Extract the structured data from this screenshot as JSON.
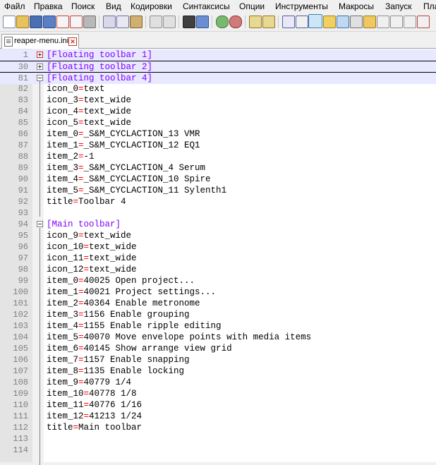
{
  "menu": [
    "Файл",
    "Правка",
    "Поиск",
    "Вид",
    "Кодировки",
    "Синтаксисы",
    "Опции",
    "Инструменты",
    "Макросы",
    "Запуск",
    "Пла"
  ],
  "tab": {
    "name": "reaper-menu.ini"
  },
  "lines": [
    {
      "n": "1",
      "text": "[Floating toolbar 1]",
      "kind": "section",
      "fold": "plus"
    },
    {
      "n": "30",
      "text": "[Floating toolbar 2]",
      "kind": "section",
      "fold": "plus"
    },
    {
      "n": "81",
      "text": "[Floating toolbar 4]",
      "kind": "section",
      "fold": "minus"
    },
    {
      "n": "82",
      "key": "icon_0",
      "val": "text"
    },
    {
      "n": "83",
      "key": "icon_3",
      "val": "text_wide"
    },
    {
      "n": "84",
      "key": "icon_4",
      "val": "text_wide"
    },
    {
      "n": "85",
      "key": "icon_5",
      "val": "text_wide"
    },
    {
      "n": "86",
      "key": "item_0",
      "val": "_S&M_CYCLACTION_13 VMR"
    },
    {
      "n": "87",
      "key": "item_1",
      "val": "_S&M_CYCLACTION_12 EQ1"
    },
    {
      "n": "88",
      "key": "item_2",
      "val": "-1"
    },
    {
      "n": "89",
      "key": "item_3",
      "val": "_S&M_CYCLACTION_4 Serum"
    },
    {
      "n": "90",
      "key": "item_4",
      "val": "_S&M_CYCLACTION_10 Spire"
    },
    {
      "n": "91",
      "key": "item_5",
      "val": "_S&M_CYCLACTION_11 Sylenth1"
    },
    {
      "n": "92",
      "key": "title",
      "val": "Toolbar 4"
    },
    {
      "n": "93",
      "text": ""
    },
    {
      "n": "94",
      "text": "[Main toolbar]",
      "kind": "section",
      "fold": "minus"
    },
    {
      "n": "95",
      "key": "icon_9",
      "val": "text_wide"
    },
    {
      "n": "96",
      "key": "icon_10",
      "val": "text_wide"
    },
    {
      "n": "97",
      "key": "icon_11",
      "val": "text_wide"
    },
    {
      "n": "98",
      "key": "icon_12",
      "val": "text_wide"
    },
    {
      "n": "99",
      "key": "item_0",
      "val": "40025 Open project..."
    },
    {
      "n": "100",
      "key": "item_1",
      "val": "40021 Project settings..."
    },
    {
      "n": "101",
      "key": "item_2",
      "val": "40364 Enable metronome"
    },
    {
      "n": "102",
      "key": "item_3",
      "val": "1156 Enable grouping"
    },
    {
      "n": "103",
      "key": "item_4",
      "val": "1155 Enable ripple editing"
    },
    {
      "n": "104",
      "key": "item_5",
      "val": "40070 Move envelope points with media items"
    },
    {
      "n": "105",
      "key": "item_6",
      "val": "40145 Show arrange view grid"
    },
    {
      "n": "106",
      "key": "item_7",
      "val": "1157 Enable snapping"
    },
    {
      "n": "107",
      "key": "item_8",
      "val": "1135 Enable locking"
    },
    {
      "n": "108",
      "key": "item_9",
      "val": "40779 1/4"
    },
    {
      "n": "109",
      "key": "item_10",
      "val": "40778 1/8"
    },
    {
      "n": "110",
      "key": "item_11",
      "val": "40776 1/16"
    },
    {
      "n": "111",
      "key": "item_12",
      "val": "41213 1/24"
    },
    {
      "n": "112",
      "key": "title",
      "val": "Main toolbar"
    },
    {
      "n": "113",
      "text": ""
    },
    {
      "n": "114",
      "text": ""
    }
  ],
  "colors": {
    "section": "#8000ff",
    "equals": "#ff0000",
    "text": "#000000",
    "lineNumber": "#808080"
  }
}
